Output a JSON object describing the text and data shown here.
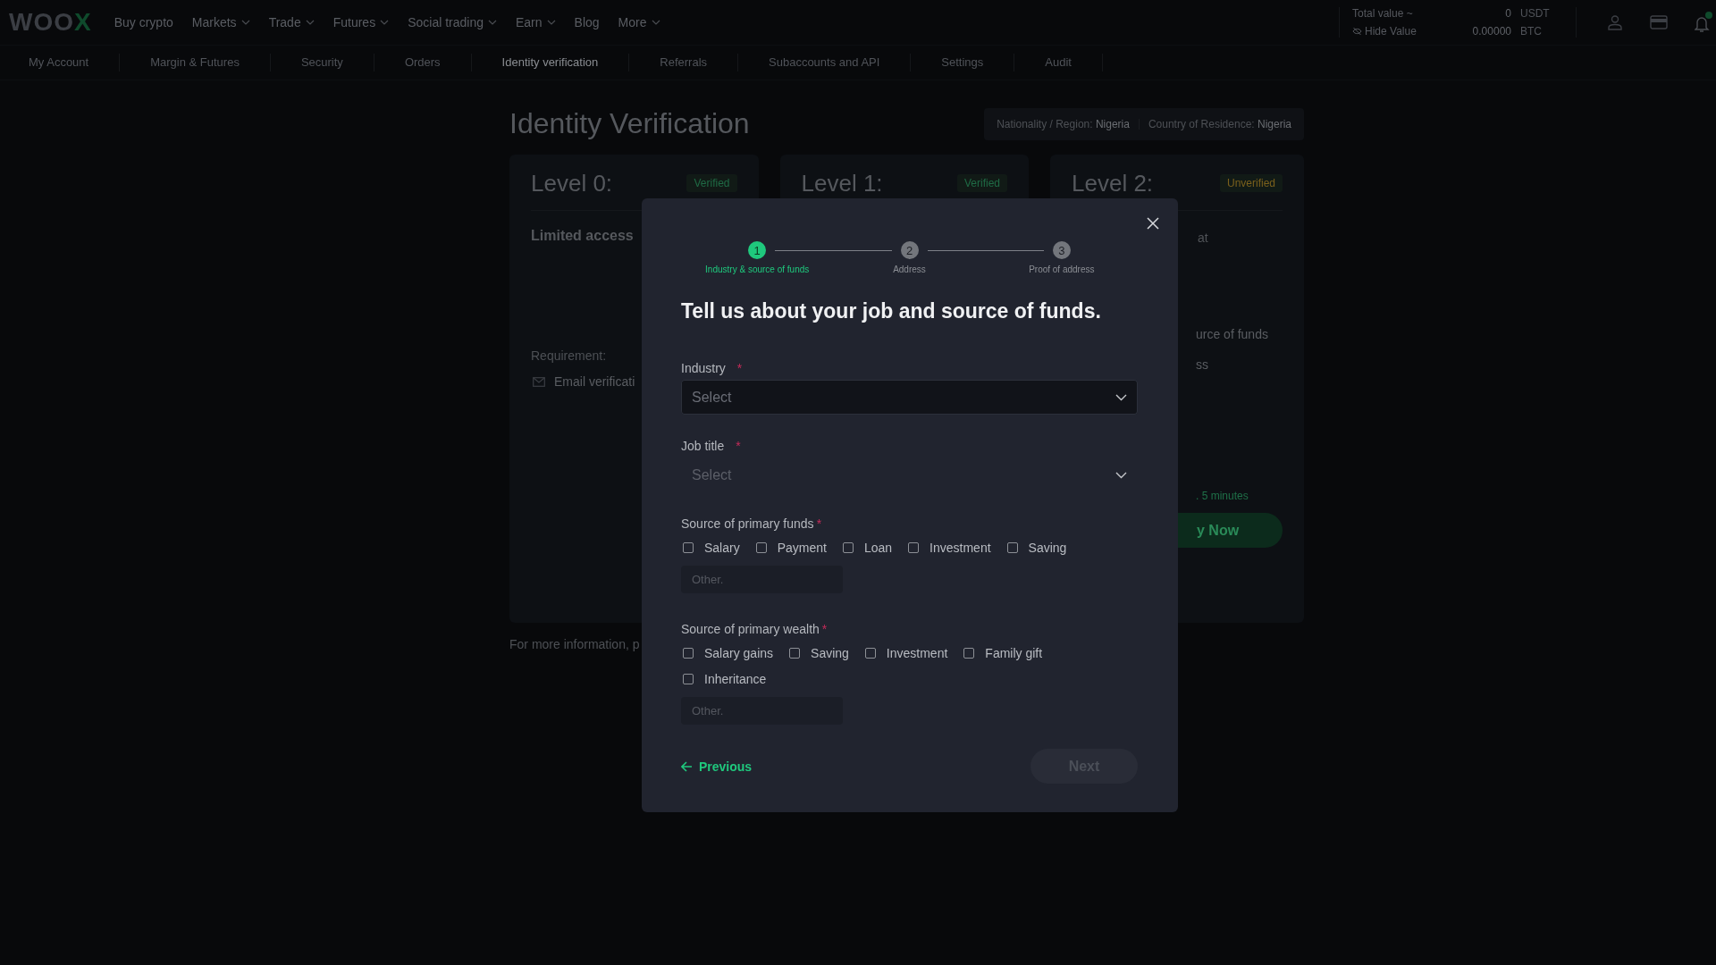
{
  "nav": {
    "logo": "WOOX",
    "items": [
      {
        "label": "Buy crypto",
        "dropdown": false
      },
      {
        "label": "Markets",
        "dropdown": true
      },
      {
        "label": "Trade",
        "dropdown": true
      },
      {
        "label": "Futures",
        "dropdown": true
      },
      {
        "label": "Social trading",
        "dropdown": true
      },
      {
        "label": "Earn",
        "dropdown": true
      },
      {
        "label": "Blog",
        "dropdown": false
      },
      {
        "label": "More",
        "dropdown": true
      }
    ]
  },
  "account": {
    "total_label": "Total value ~",
    "total_value": "0",
    "total_unit": "USDT",
    "hide_label": "Hide Value",
    "btc_value": "0.00000",
    "btc_unit": "BTC"
  },
  "tabs": [
    {
      "label": "My Account",
      "selected": false
    },
    {
      "label": "Margin & Futures",
      "selected": false
    },
    {
      "label": "Security",
      "selected": false
    },
    {
      "label": "Orders",
      "selected": false
    },
    {
      "label": "Identity verification",
      "selected": true
    },
    {
      "label": "Referrals",
      "selected": false
    },
    {
      "label": "Subaccounts and API",
      "selected": false
    },
    {
      "label": "Settings",
      "selected": false
    },
    {
      "label": "Audit",
      "selected": false
    }
  ],
  "page": {
    "title": "Identity Verification",
    "nationality_label": "Nationality / Region:",
    "nationality": "Nigeria",
    "residence_label": "Country of Residence:",
    "residence": "Nigeria"
  },
  "levels": [
    {
      "title": "Level 0:",
      "status": "Verified",
      "color": "#1f6b45",
      "texts": [
        {
          "kind": "heading",
          "text": "Limited access"
        },
        {
          "kind": "label",
          "text": "Requirement:"
        },
        {
          "kind": "item",
          "text": "Email verificati"
        }
      ]
    },
    {
      "title": "Level 1:",
      "status": "Verified",
      "color": "#1f6b45"
    },
    {
      "title": "Level 2:",
      "status": "Unverified",
      "color": "#7a601c",
      "texts": [
        {
          "kind": "fragment",
          "text": "at"
        },
        {
          "kind": "fragment",
          "text": "urce of funds"
        },
        {
          "kind": "fragment",
          "text": "ss"
        },
        {
          "kind": "time",
          "text": ". 5 minutes"
        },
        {
          "kind": "button",
          "text": "y Now"
        }
      ]
    }
  ],
  "footer_note": "For more information, p",
  "modal": {
    "steps": [
      {
        "number": "1",
        "label": "Industry & source of funds",
        "active": true
      },
      {
        "number": "2",
        "label": "Address",
        "active": false
      },
      {
        "number": "3",
        "label": "Proof of address",
        "active": false
      }
    ],
    "title": "Tell us about your job and source of funds.",
    "selects": [
      {
        "label": "Industry",
        "required_mark": "*",
        "placeholder": "Select",
        "focused": true
      },
      {
        "label": "Job title",
        "required_mark": "*",
        "placeholder": "Select",
        "focused": false
      }
    ],
    "groups": [
      {
        "label": "Source of primary funds",
        "required_mark": "*",
        "options": [
          {
            "label": "Salary",
            "checked": false
          },
          {
            "label": "Payment",
            "checked": false
          },
          {
            "label": "Loan",
            "checked": false
          },
          {
            "label": "Investment",
            "checked": false
          },
          {
            "label": "Saving",
            "checked": false
          }
        ],
        "other_placeholder": "Other."
      },
      {
        "label": "Source of primary wealth",
        "required_mark": "*",
        "options": [
          {
            "label": "Salary gains",
            "checked": false
          },
          {
            "label": "Saving",
            "checked": false
          },
          {
            "label": "Investment",
            "checked": false
          },
          {
            "label": "Family gift",
            "checked": false
          },
          {
            "label": "Inheritance",
            "checked": false
          }
        ],
        "other_placeholder": "Other."
      }
    ],
    "previous": "Previous",
    "next": {
      "label": "Next",
      "disabled": true
    }
  }
}
